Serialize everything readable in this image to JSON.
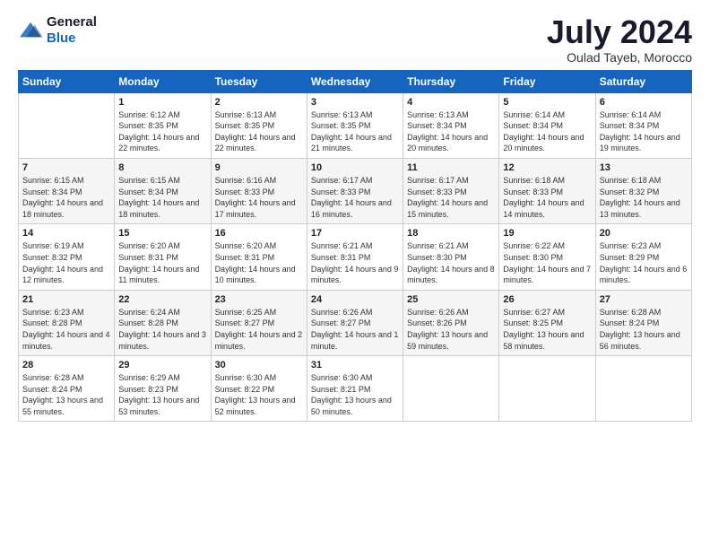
{
  "header": {
    "logo_general": "General",
    "logo_blue": "Blue",
    "title": "July 2024",
    "subtitle": "Oulad Tayeb, Morocco"
  },
  "days_of_week": [
    "Sunday",
    "Monday",
    "Tuesday",
    "Wednesday",
    "Thursday",
    "Friday",
    "Saturday"
  ],
  "weeks": [
    [
      {
        "day": "",
        "info": ""
      },
      {
        "day": "1",
        "info": "Sunrise: 6:12 AM\nSunset: 8:35 PM\nDaylight: 14 hours\nand 22 minutes."
      },
      {
        "day": "2",
        "info": "Sunrise: 6:13 AM\nSunset: 8:35 PM\nDaylight: 14 hours\nand 22 minutes."
      },
      {
        "day": "3",
        "info": "Sunrise: 6:13 AM\nSunset: 8:35 PM\nDaylight: 14 hours\nand 21 minutes."
      },
      {
        "day": "4",
        "info": "Sunrise: 6:13 AM\nSunset: 8:34 PM\nDaylight: 14 hours\nand 20 minutes."
      },
      {
        "day": "5",
        "info": "Sunrise: 6:14 AM\nSunset: 8:34 PM\nDaylight: 14 hours\nand 20 minutes."
      },
      {
        "day": "6",
        "info": "Sunrise: 6:14 AM\nSunset: 8:34 PM\nDaylight: 14 hours\nand 19 minutes."
      }
    ],
    [
      {
        "day": "7",
        "info": "Sunrise: 6:15 AM\nSunset: 8:34 PM\nDaylight: 14 hours\nand 18 minutes."
      },
      {
        "day": "8",
        "info": "Sunrise: 6:15 AM\nSunset: 8:34 PM\nDaylight: 14 hours\nand 18 minutes."
      },
      {
        "day": "9",
        "info": "Sunrise: 6:16 AM\nSunset: 8:33 PM\nDaylight: 14 hours\nand 17 minutes."
      },
      {
        "day": "10",
        "info": "Sunrise: 6:17 AM\nSunset: 8:33 PM\nDaylight: 14 hours\nand 16 minutes."
      },
      {
        "day": "11",
        "info": "Sunrise: 6:17 AM\nSunset: 8:33 PM\nDaylight: 14 hours\nand 15 minutes."
      },
      {
        "day": "12",
        "info": "Sunrise: 6:18 AM\nSunset: 8:33 PM\nDaylight: 14 hours\nand 14 minutes."
      },
      {
        "day": "13",
        "info": "Sunrise: 6:18 AM\nSunset: 8:32 PM\nDaylight: 14 hours\nand 13 minutes."
      }
    ],
    [
      {
        "day": "14",
        "info": "Sunrise: 6:19 AM\nSunset: 8:32 PM\nDaylight: 14 hours\nand 12 minutes."
      },
      {
        "day": "15",
        "info": "Sunrise: 6:20 AM\nSunset: 8:31 PM\nDaylight: 14 hours\nand 11 minutes."
      },
      {
        "day": "16",
        "info": "Sunrise: 6:20 AM\nSunset: 8:31 PM\nDaylight: 14 hours\nand 10 minutes."
      },
      {
        "day": "17",
        "info": "Sunrise: 6:21 AM\nSunset: 8:31 PM\nDaylight: 14 hours\nand 9 minutes."
      },
      {
        "day": "18",
        "info": "Sunrise: 6:21 AM\nSunset: 8:30 PM\nDaylight: 14 hours\nand 8 minutes."
      },
      {
        "day": "19",
        "info": "Sunrise: 6:22 AM\nSunset: 8:30 PM\nDaylight: 14 hours\nand 7 minutes."
      },
      {
        "day": "20",
        "info": "Sunrise: 6:23 AM\nSunset: 8:29 PM\nDaylight: 14 hours\nand 6 minutes."
      }
    ],
    [
      {
        "day": "21",
        "info": "Sunrise: 6:23 AM\nSunset: 8:28 PM\nDaylight: 14 hours\nand 4 minutes."
      },
      {
        "day": "22",
        "info": "Sunrise: 6:24 AM\nSunset: 8:28 PM\nDaylight: 14 hours\nand 3 minutes."
      },
      {
        "day": "23",
        "info": "Sunrise: 6:25 AM\nSunset: 8:27 PM\nDaylight: 14 hours\nand 2 minutes."
      },
      {
        "day": "24",
        "info": "Sunrise: 6:26 AM\nSunset: 8:27 PM\nDaylight: 14 hours\nand 1 minute."
      },
      {
        "day": "25",
        "info": "Sunrise: 6:26 AM\nSunset: 8:26 PM\nDaylight: 13 hours\nand 59 minutes."
      },
      {
        "day": "26",
        "info": "Sunrise: 6:27 AM\nSunset: 8:25 PM\nDaylight: 13 hours\nand 58 minutes."
      },
      {
        "day": "27",
        "info": "Sunrise: 6:28 AM\nSunset: 8:24 PM\nDaylight: 13 hours\nand 56 minutes."
      }
    ],
    [
      {
        "day": "28",
        "info": "Sunrise: 6:28 AM\nSunset: 8:24 PM\nDaylight: 13 hours\nand 55 minutes."
      },
      {
        "day": "29",
        "info": "Sunrise: 6:29 AM\nSunset: 8:23 PM\nDaylight: 13 hours\nand 53 minutes."
      },
      {
        "day": "30",
        "info": "Sunrise: 6:30 AM\nSunset: 8:22 PM\nDaylight: 13 hours\nand 52 minutes."
      },
      {
        "day": "31",
        "info": "Sunrise: 6:30 AM\nSunset: 8:21 PM\nDaylight: 13 hours\nand 50 minutes."
      },
      {
        "day": "",
        "info": ""
      },
      {
        "day": "",
        "info": ""
      },
      {
        "day": "",
        "info": ""
      }
    ]
  ]
}
